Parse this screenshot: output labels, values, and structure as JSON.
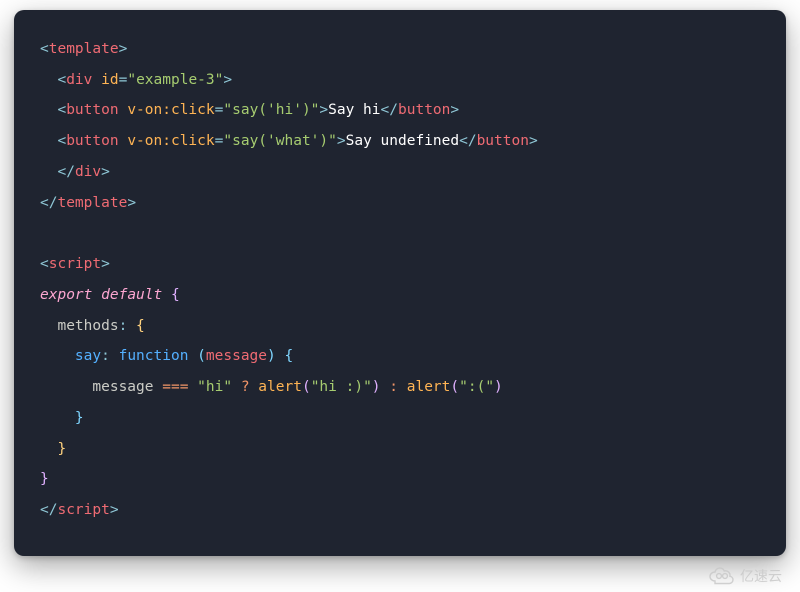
{
  "code": {
    "l1": {
      "tag_open": "<",
      "tag": "template",
      "tag_close": ">"
    },
    "l2": {
      "ind": "  ",
      "tag_open": "<",
      "tag": "div",
      "sp": " ",
      "attr": "id",
      "eq": "=",
      "val": "\"example-3\"",
      "tag_close": ">"
    },
    "l3": {
      "ind": "  ",
      "tag_open": "<",
      "tag": "button",
      "sp": " ",
      "attr": "v-on:click",
      "eq": "=",
      "val": "\"say('hi')\"",
      "tag_close": ">",
      "text": "Say hi",
      "close_open": "</",
      "tag2": "button",
      "close_close": ">"
    },
    "l4": {
      "ind": "  ",
      "tag_open": "<",
      "tag": "button",
      "sp": " ",
      "attr": "v-on:click",
      "eq": "=",
      "val": "\"say('what')\"",
      "tag_close": ">",
      "text": "Say undefined",
      "close_open": "</",
      "tag2": "button",
      "close_close": ">"
    },
    "l5": {
      "ind": "  ",
      "tag_open": "</",
      "tag": "div",
      "tag_close": ">"
    },
    "l6": {
      "tag_open": "</",
      "tag": "template",
      "tag_close": ">"
    },
    "l8": {
      "tag_open": "<",
      "tag": "script",
      "tag_close": ">"
    },
    "l9": {
      "export": "export",
      "sp": " ",
      "default": "default",
      "sp2": " ",
      "brace": "{"
    },
    "l10": {
      "ind": "  ",
      "key": "methods",
      "colon": ": ",
      "brace": "{"
    },
    "l11": {
      "ind": "    ",
      "key": "say",
      "colon": ": ",
      "func": "function",
      "sp": " ",
      "p1": "(",
      "param": "message",
      "p2": ")",
      "sp2": " ",
      "brace": "{"
    },
    "l12": {
      "ind": "      ",
      "id": "message",
      "sp": " ",
      "op1": "===",
      "sp2": " ",
      "str1": "\"hi\"",
      "sp3": " ",
      "op2": "?",
      "sp4": " ",
      "fn1": "alert",
      "p1": "(",
      "arg1": "\"hi :)\"",
      "p2": ")",
      "sp5": " ",
      "op3": ":",
      "sp6": " ",
      "fn2": "alert",
      "p3": "(",
      "arg2": "\":(\"",
      "p4": ")"
    },
    "l13": {
      "ind": "    ",
      "brace": "}"
    },
    "l14": {
      "ind": "  ",
      "brace": "}"
    },
    "l15": {
      "brace": "}"
    },
    "l16": {
      "tag_open": "</",
      "tag": "script",
      "tag_close": ">"
    }
  },
  "watermark": {
    "text": "亿速云"
  }
}
